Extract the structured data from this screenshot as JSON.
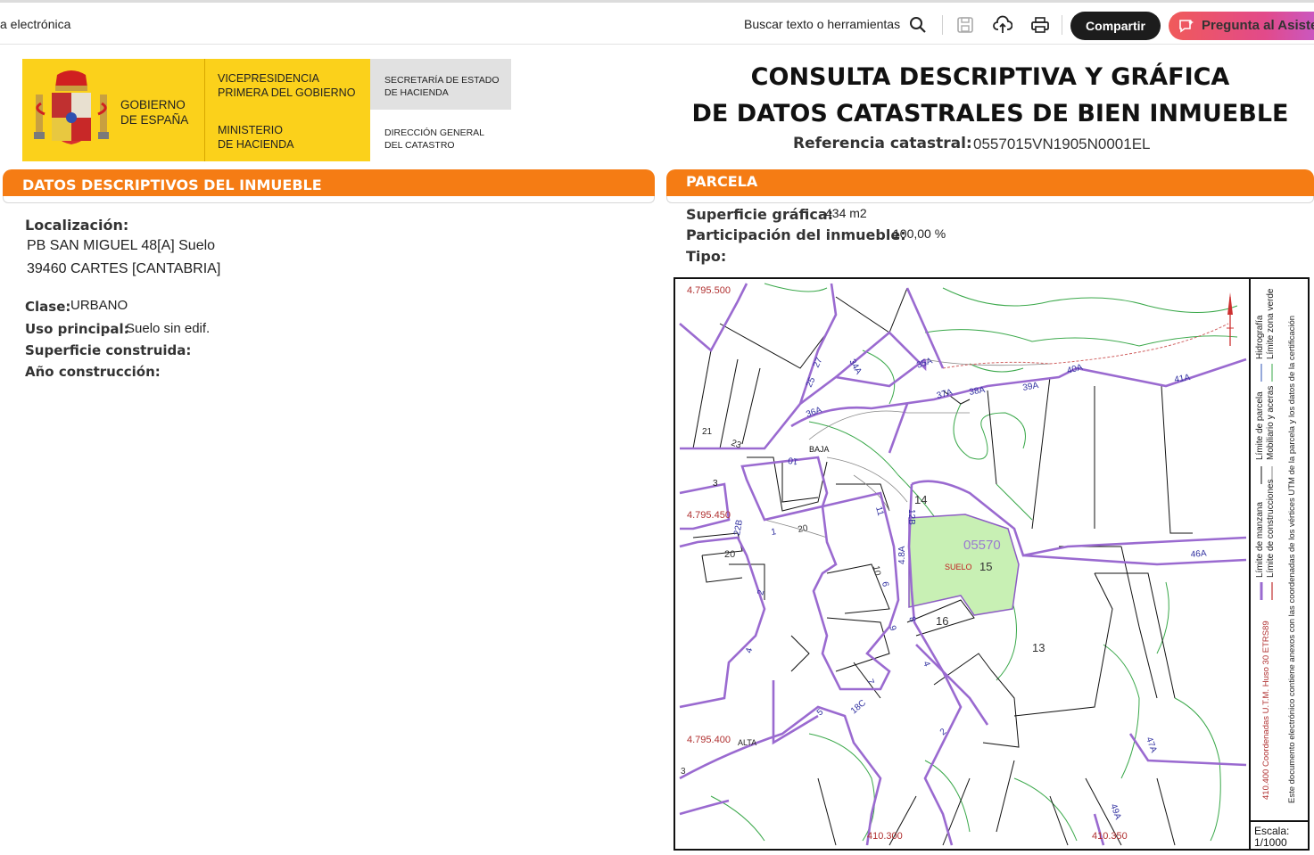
{
  "toolbar": {
    "doc_title": "a electrónica",
    "search_label": "Buscar texto o herramientas",
    "share_label": "Compartir",
    "assistant_label": "Pregunta al Asistente"
  },
  "header": {
    "gobierno": [
      "GOBIERNO",
      "DE ESPAÑA"
    ],
    "vicepresidencia": [
      "VICEPRESIDENCIA",
      "PRIMERA DEL GOBIERNO"
    ],
    "ministerio": [
      "MINISTERIO",
      "DE HACIENDA"
    ],
    "secretaria": [
      "SECRETARÍA DE ESTADO",
      "DE HACIENDA"
    ],
    "direccion": [
      "DIRECCIÓN GENERAL",
      "DEL CATASTRO"
    ],
    "title_line1": "CONSULTA DESCRIPTIVA Y GRÁFICA",
    "title_line2": "DE DATOS CATASTRALES DE BIEN INMUEBLE",
    "ref_label": "Referencia catastral:",
    "ref_value": "0557015VN1905N0001EL"
  },
  "descriptivos": {
    "heading": "DATOS DESCRIPTIVOS DEL INMUEBLE",
    "localizacion_label": "Localización:",
    "address_line1": "PB SAN MIGUEL 48[A] Suelo",
    "address_line2": "39460 CARTES [CANTABRIA]",
    "clase_label": "Clase:",
    "clase_value": "URBANO",
    "uso_label": "Uso principal:",
    "uso_value": "Suelo sin edif.",
    "sup_construida_label": "Superficie construida:",
    "ano_label": "Año construcción:"
  },
  "parcela": {
    "heading": "PARCELA",
    "sup_grafica_label": "Superficie gráfica:",
    "sup_grafica_value": "434 m2",
    "participacion_label": "Participación del inmueble:",
    "participacion_value": "100,00 %",
    "tipo_label": "Tipo:"
  },
  "map": {
    "coord_y_top": "4.795.500",
    "coord_y_mid": "4.795.450",
    "coord_y_bot": "4.795.400",
    "coord_x_left": "410.300",
    "coord_x_right": "410.350",
    "parcel_code": "05570",
    "parcel_num": "15",
    "suelo": "SUELO",
    "labels": [
      "34A",
      "35A",
      "27",
      "25",
      "36A",
      "37A",
      "38A",
      "39A",
      "40A",
      "41A",
      "21",
      "23",
      "BAJA",
      "10",
      "3",
      "14",
      "12B",
      "11",
      "4.8A",
      "20",
      "22B",
      "1",
      "20",
      "2",
      "46A",
      "10",
      "6",
      "16",
      "13",
      "8",
      "9",
      "4",
      "7",
      "5",
      "18C",
      "ALTA",
      "4",
      "2",
      "47A",
      "3",
      "49A"
    ],
    "scale_label": "Escala:",
    "scale_value": "1/1000",
    "legend_limite_manzana": "Límite de manzana",
    "legend_limite_parcela": "Límite de parcela",
    "legend_hidrografia": "Hidrografía",
    "legend_limite_construcciones": "Límite de construcciones",
    "legend_mobiliario": "Mobiliario y aceras",
    "legend_zona_verde": "Límite zona verde",
    "legend_coordenadas": "410.400 Coordenadas U.T.M. Huso 30 ETRS89",
    "legend_documento": "Este documento electrónico contiene anexos con las coordenadas de los vértices UTM de la parcela y los datos de la certificación"
  }
}
